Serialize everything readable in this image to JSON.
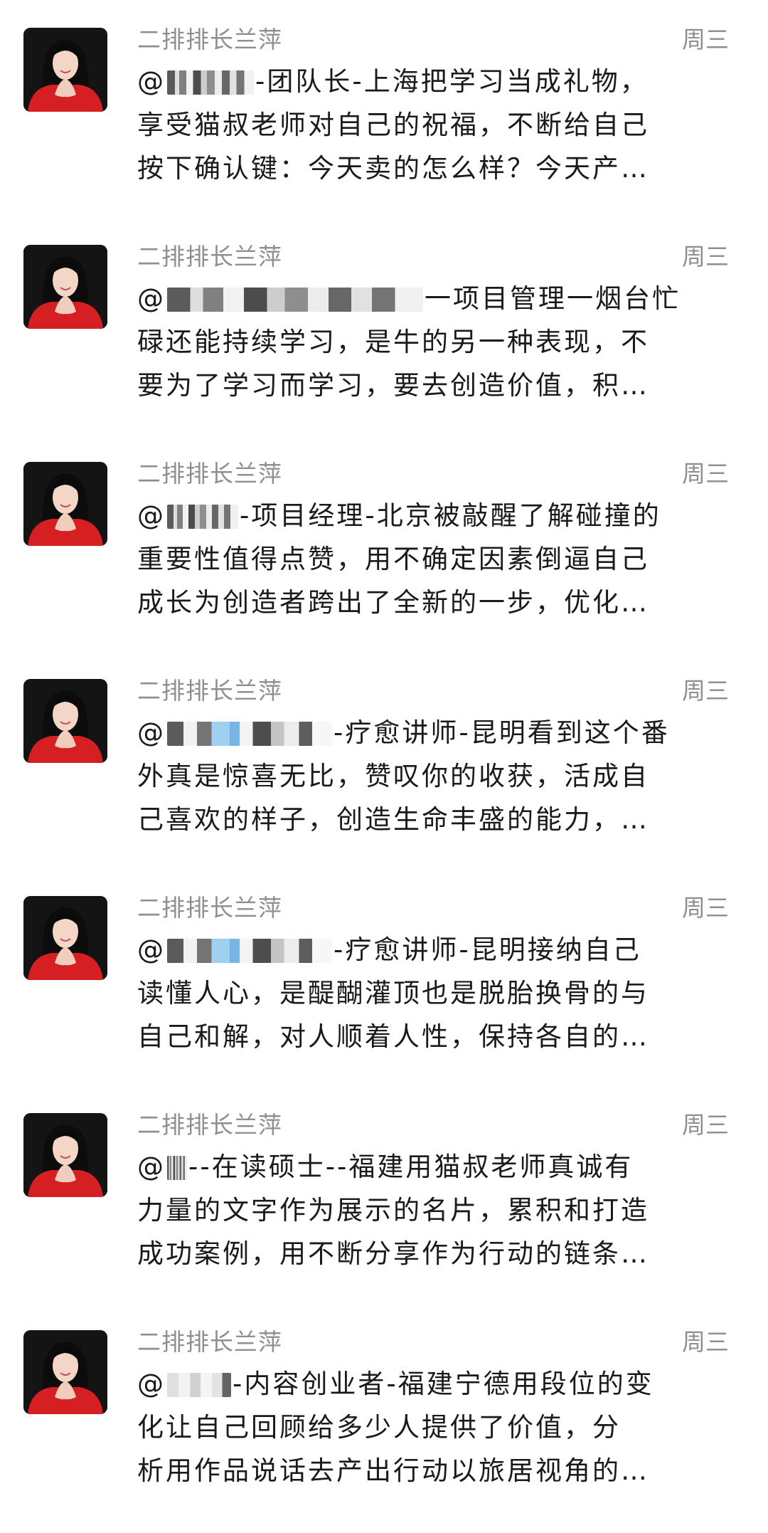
{
  "feed": {
    "items": [
      {
        "author": "二排排长兰萍",
        "time": "周三",
        "mention_prefix": "@",
        "lines": [
          "-团队长-上海把学习当成礼物，",
          "享受猫叔老师对自己的祝福，不断给自己",
          "按下确认键：今天卖的怎么样？今天产…"
        ]
      },
      {
        "author": "二排排长兰萍",
        "time": "周三",
        "mention_prefix": "@",
        "lines": [
          "一项目管理一烟台忙",
          "碌还能持续学习，是牛的另一种表现，不",
          "要为了学习而学习，要去创造价值，积…"
        ]
      },
      {
        "author": "二排排长兰萍",
        "time": "周三",
        "mention_prefix": "@",
        "lines": [
          "-项目经理-北京被敲醒了解碰撞的",
          "重要性值得点赞，用不确定因素倒逼自己",
          "成长为创造者跨出了全新的一步，优化…"
        ]
      },
      {
        "author": "二排排长兰萍",
        "time": "周三",
        "mention_prefix": "@",
        "lines": [
          "-疗愈讲师-昆明看到这个番",
          "外真是惊喜无比，赞叹你的收获，活成自",
          "己喜欢的样子，创造生命丰盛的能力，…"
        ]
      },
      {
        "author": "二排排长兰萍",
        "time": "周三",
        "mention_prefix": "@",
        "lines": [
          "-疗愈讲师-昆明接纳自己",
          "读懂人心，是醍醐灌顶也是脱胎换骨的与",
          "自己和解，对人顺着人性，保持各自的…"
        ]
      },
      {
        "author": "二排排长兰萍",
        "time": "周三",
        "mention_prefix": "@",
        "lines": [
          "--在读硕士--福建用猫叔老师真诚有",
          "力量的文字作为展示的名片，累积和打造",
          "成功案例，用不断分享作为行动的链条…"
        ]
      },
      {
        "author": "二排排长兰萍",
        "time": "周三",
        "mention_prefix": "@",
        "lines": [
          "-内容创业者-福建宁德用段位的变",
          "化让自己回顾给多少人提供了价值，分",
          "析用作品说话去产出行动以旅居视角的…"
        ]
      }
    ]
  }
}
